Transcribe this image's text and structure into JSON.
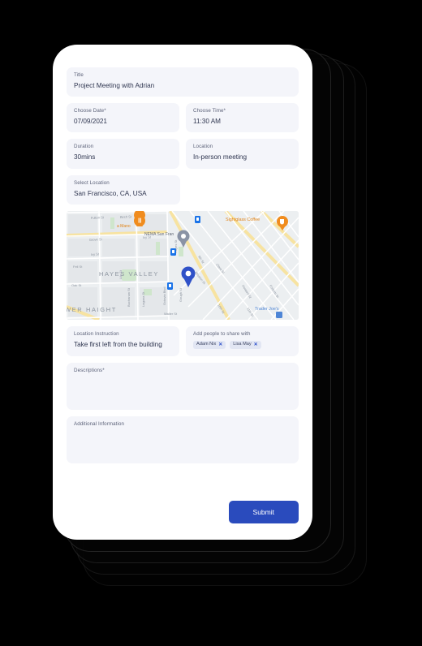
{
  "form": {
    "title_field": {
      "label": "Title",
      "value": "Project Meeting with Adrian"
    },
    "date_field": {
      "label": "Choose Date*",
      "value": "07/09/2021"
    },
    "time_field": {
      "label": "Choose Time*",
      "value": "11:30 AM"
    },
    "duration_field": {
      "label": "Duration",
      "value": "30mins"
    },
    "location_field": {
      "label": "Location",
      "value": "In-person meeting"
    },
    "select_location": {
      "label": "Select Location",
      "value": "San Francisco, CA, USA"
    },
    "instruction": {
      "label": "Location Instruction",
      "value": "Take first left from the building"
    },
    "share": {
      "label": "Add people to share with",
      "chips": [
        {
          "name": "Adam Nix",
          "remove_icon": "close-icon"
        },
        {
          "name": "Lisa May",
          "remove_icon": "close-icon"
        }
      ]
    },
    "descriptions": {
      "label": "Descriptions*",
      "value": ""
    },
    "additional_info": {
      "label": "Additional Information",
      "value": ""
    },
    "submit_label": "Submit"
  },
  "map": {
    "neighborhood_labels": [
      "HAYES VALLEY",
      "WER HAIGHT"
    ],
    "poi_labels": [
      "a Mano",
      "NEMA San Fran",
      "Sightglass Coffee",
      "Trader Joe's"
    ],
    "street_labels": [
      "Fulton St",
      "Birch St",
      "Grove St",
      "Ivy St",
      "Hayes St",
      "Fell St",
      "Oak St",
      "Octavia Blvd",
      "Gough St",
      "Laguna St",
      "Buchanan St",
      "Waller St",
      "9th St",
      "10th St",
      "11th St",
      "Howard St",
      "Folsom St",
      "Mission St",
      "Valencia St",
      "Clara St",
      "Lily St"
    ],
    "markers": [
      {
        "type": "selected-pin",
        "color": "#2f51c8"
      },
      {
        "type": "poi-pin",
        "color": "#8a93a5"
      },
      {
        "type": "restaurant-pin",
        "color": "#f08c1e"
      },
      {
        "type": "cafe-pin",
        "color": "#f08c1e"
      },
      {
        "type": "transit-marker",
        "color": "#1a73e8"
      }
    ]
  },
  "colors": {
    "accent": "#2a4bbd",
    "field_bg": "#f4f5fa",
    "chip_bg": "#e2e6f3",
    "page_bg": "#000000",
    "card_bg": "#ffffff"
  }
}
